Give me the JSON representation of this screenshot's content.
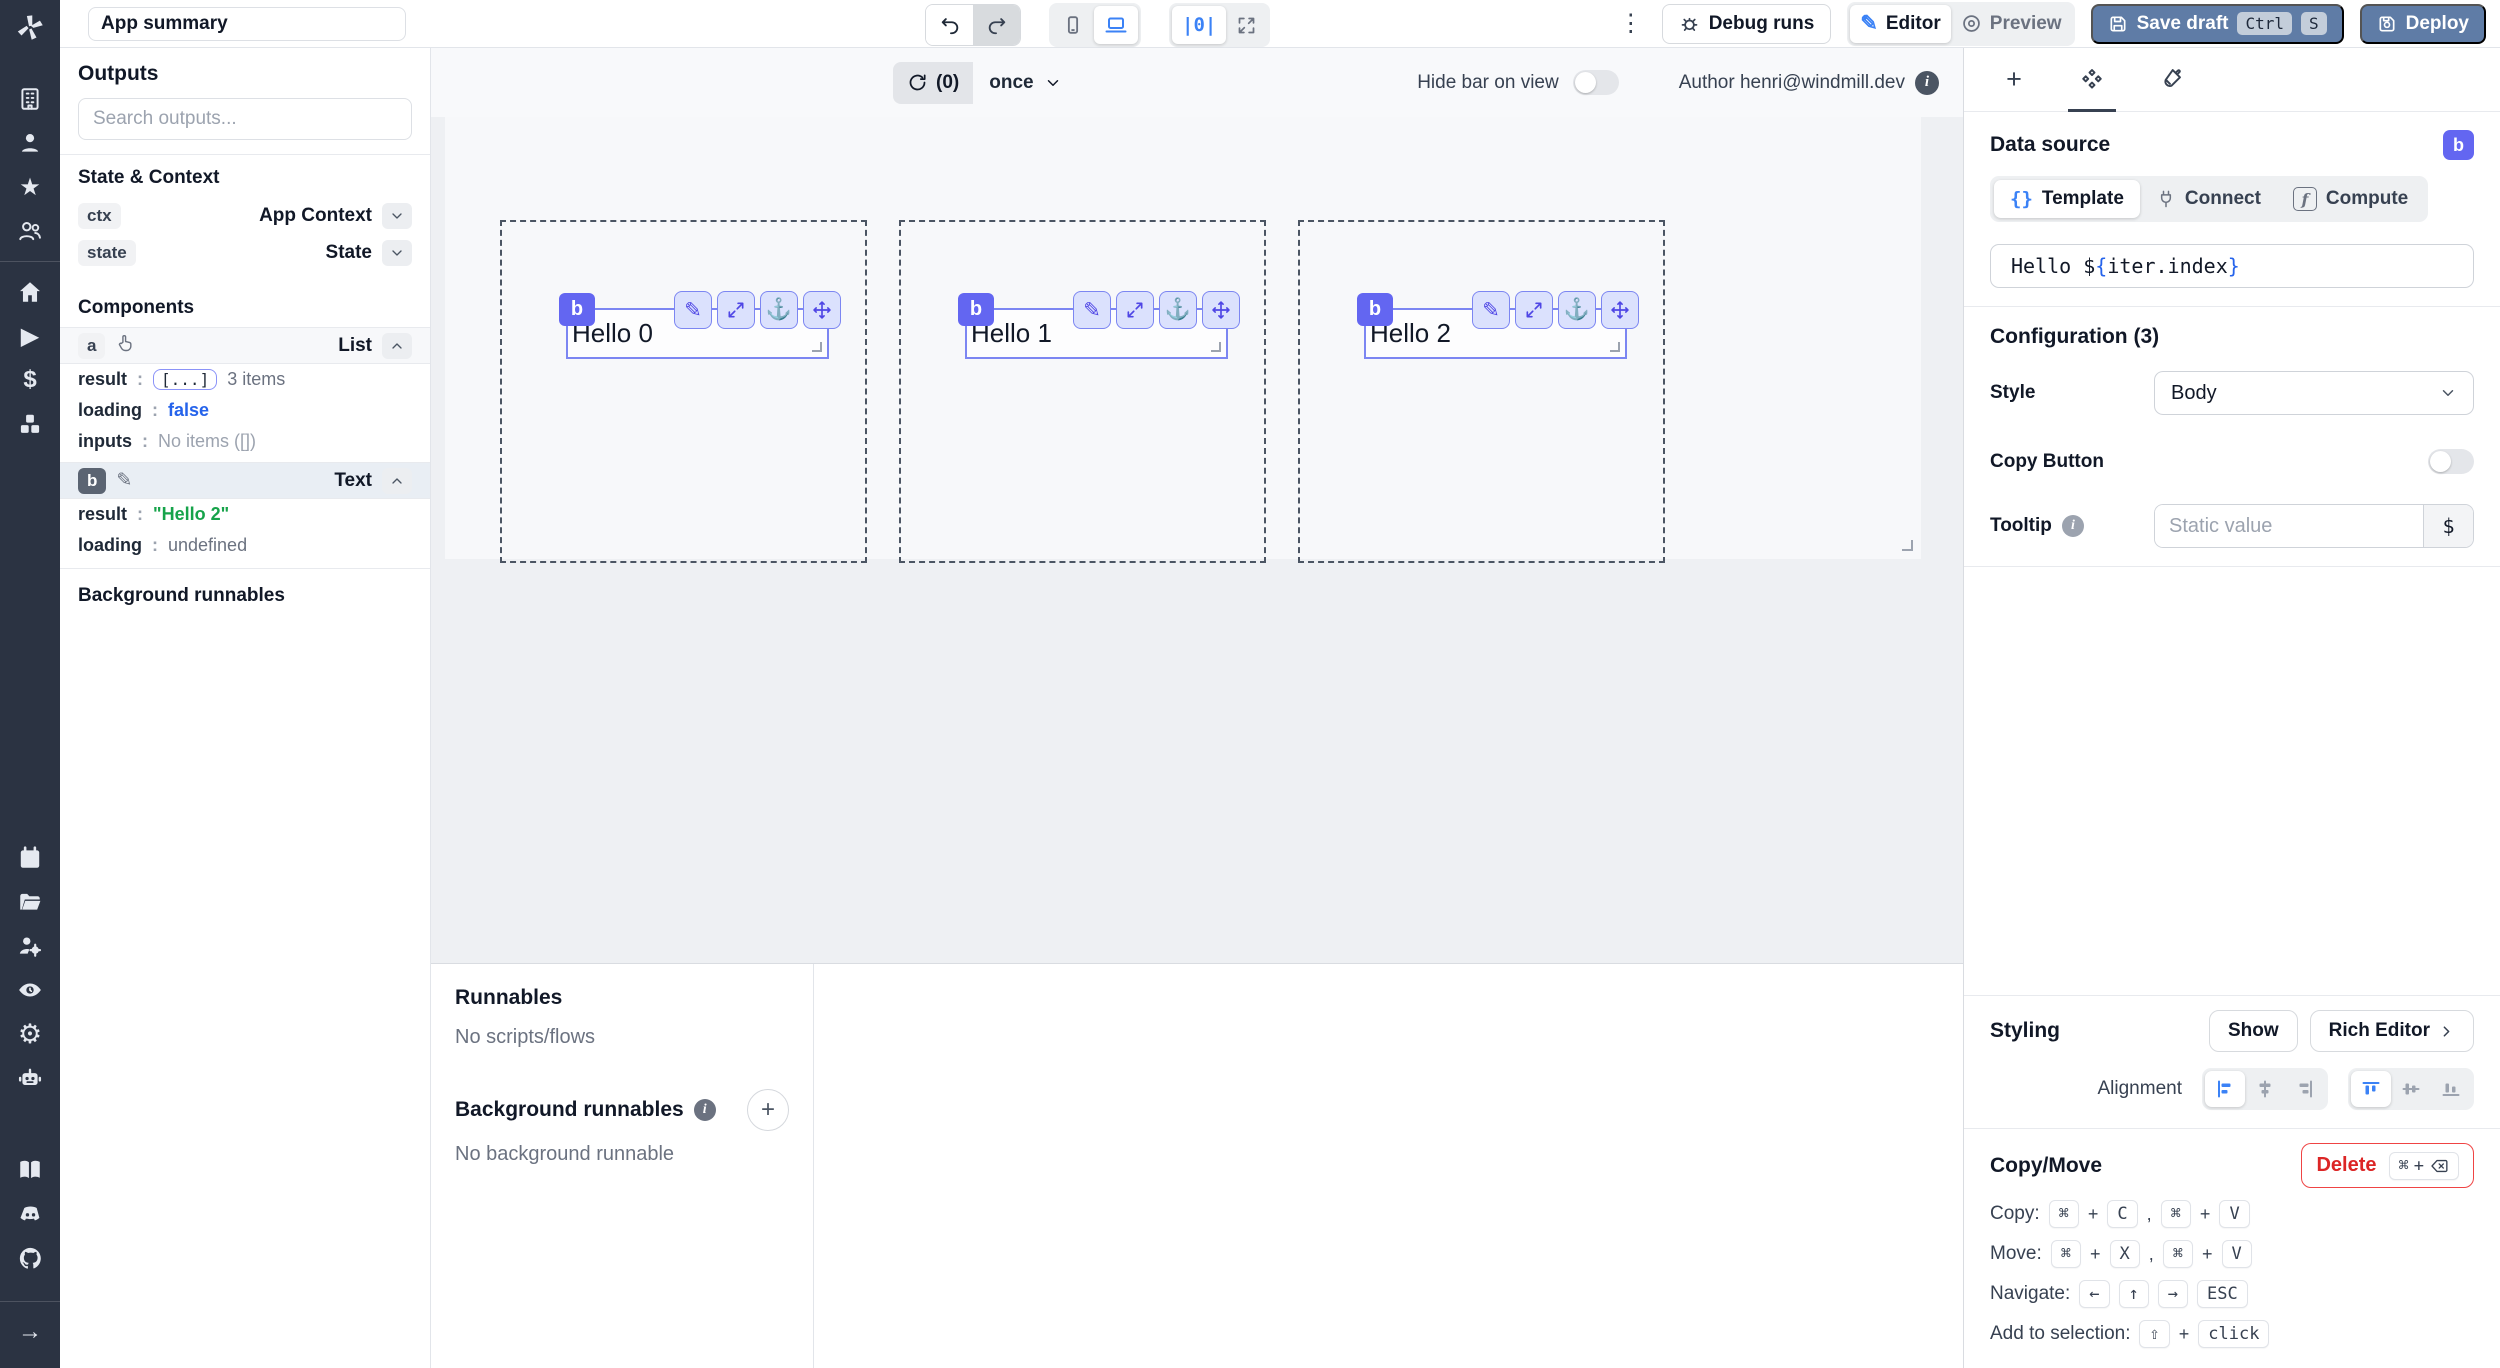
{
  "topbar": {
    "app_summary_value": "App summary",
    "kebab": "⋮",
    "debug_runs": "Debug runs",
    "editor": "Editor",
    "preview": "Preview",
    "save_draft": "Save draft",
    "save_kbd_ctrl": "Ctrl",
    "save_kbd_s": "S",
    "deploy": "Deploy",
    "center_align_glyph": "|0|"
  },
  "rail": {
    "icons": [
      "windmill-logo",
      "building",
      "person",
      "star",
      "users",
      "home",
      "play",
      "dollar",
      "cubes",
      "calendar",
      "folder",
      "user-settings",
      "audit-eye",
      "gear",
      "robot",
      "book",
      "discord",
      "github",
      "arrow-right"
    ],
    "play_glyph": "▶",
    "star_glyph": "★",
    "dollar_glyph": "$",
    "gear_glyph": "⚙",
    "arrow_glyph": "→"
  },
  "sidebar": {
    "outputs_title": "Outputs",
    "search_placeholder": "Search outputs...",
    "state_context_title": "State & Context",
    "colon": ":",
    "ctx": {
      "id": "ctx",
      "type": "App Context"
    },
    "state": {
      "id": "state",
      "type": "State"
    },
    "components_title": "Components",
    "comp_a": {
      "id": "a",
      "type": "List",
      "result_label": "result",
      "result_chip": "[...]",
      "result_items": "3 items",
      "loading_label": "loading",
      "loading_value": "false",
      "inputs_label": "inputs",
      "inputs_value": "No items ([])"
    },
    "comp_b": {
      "id": "b",
      "type": "Text",
      "pencil": "✎",
      "result_label": "result",
      "result_value": "\"Hello 2\"",
      "loading_label": "loading",
      "loading_value": "undefined"
    },
    "background_title": "Background runnables"
  },
  "canvas": {
    "refresh_count": "(0)",
    "refresh_mode": "once",
    "hide_bar_label": "Hide bar on view",
    "author_label": "Author henri@windmill.dev",
    "info_glyph": "i",
    "items": [
      {
        "badge": "b",
        "text": "Hello 0"
      },
      {
        "badge": "b",
        "text": "Hello 1"
      },
      {
        "badge": "b",
        "text": "Hello 2"
      }
    ],
    "handle_pencil": "✎",
    "handle_anchor": "⚓"
  },
  "runnables": {
    "title": "Runnables",
    "empty": "No scripts/flows",
    "background_title": "Background runnables",
    "background_empty": "No background runnable",
    "add": "+"
  },
  "panel": {
    "tabs_add": "+",
    "data_source_title": "Data source",
    "badge": "b",
    "tabs": {
      "template": "Template",
      "connect": "Connect",
      "compute": "Compute",
      "template_icon": "{}",
      "compute_icon": "f"
    },
    "expr": {
      "prefix": "Hello $",
      "open": "{",
      "inner": "iter.index",
      "close": "}"
    },
    "configuration_title": "Configuration (3)",
    "style_label": "Style",
    "style_value": "Body",
    "copy_button_label": "Copy Button",
    "tooltip_label": "Tooltip",
    "tooltip_placeholder": "Static value",
    "tooltip_btn": "$",
    "styling_title": "Styling",
    "show_btn": "Show",
    "rich_editor_btn": "Rich Editor",
    "alignment_label": "Alignment",
    "copy_move_title": "Copy/Move",
    "delete_btn": "Delete",
    "kbd": {
      "cmd": "⌘",
      "plus": "+",
      "comma": ",",
      "c": "C",
      "v": "V",
      "x": "X",
      "left": "←",
      "up": "↑",
      "right": "→",
      "esc": "ESC",
      "shift": "⇧",
      "click": "click"
    },
    "rows": {
      "copy": "Copy:",
      "move": "Move:",
      "navigate": "Navigate:",
      "add": "Add to selection:"
    }
  }
}
